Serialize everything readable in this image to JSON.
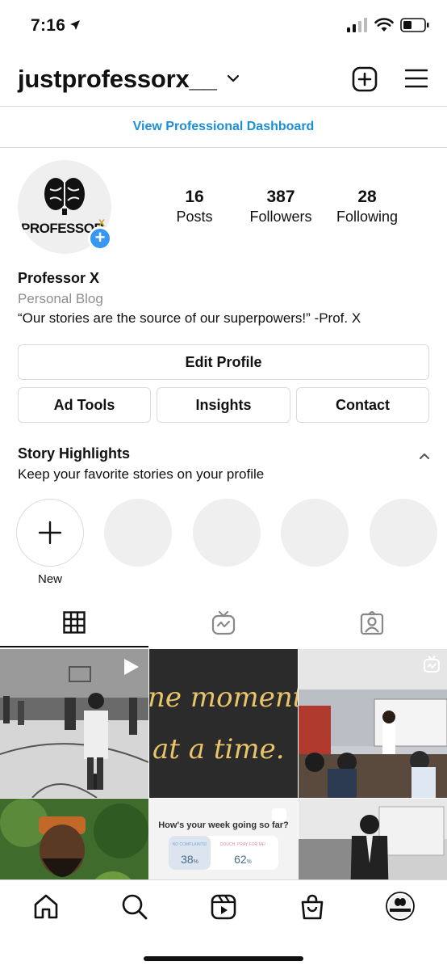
{
  "status_bar": {
    "time": "7:16"
  },
  "header": {
    "username": "justprofessorx__"
  },
  "dashboard_link": "View Professional Dashboard",
  "profile": {
    "avatar_text": "PROFESSOR X",
    "stats": [
      {
        "value": "16",
        "label": "Posts"
      },
      {
        "value": "387",
        "label": "Followers"
      },
      {
        "value": "28",
        "label": "Following"
      }
    ],
    "name": "Professor X",
    "category": "Personal Blog",
    "bio": "“Our stories are the source of our superpowers!” -Prof. X"
  },
  "buttons": {
    "edit_profile": "Edit Profile",
    "ad_tools": "Ad Tools",
    "insights": "Insights",
    "contact": "Contact"
  },
  "highlights": {
    "title": "Story Highlights",
    "subtitle": "Keep your favorite stories on your profile",
    "new_label": "New"
  },
  "tabs": [
    "grid-icon",
    "igtv-icon",
    "tagged-icon"
  ],
  "posts": [
    {
      "kind": "photo",
      "desc": "gym"
    },
    {
      "kind": "text",
      "lines": [
        "ne moment",
        "at a time."
      ]
    },
    {
      "kind": "photo",
      "desc": "classroom"
    },
    {
      "kind": "photo",
      "desc": "portrait"
    },
    {
      "kind": "poll",
      "question": "How's your week going so far?",
      "option_a_label": "NO COMPLAINTS!",
      "option_a_pct": "38",
      "option_b_label": "OOUCH. PRAY FOR ME!",
      "option_b_pct": "62",
      "pct_suffix": "%"
    },
    {
      "kind": "photo",
      "desc": "speaker"
    }
  ],
  "nav": [
    "home-icon",
    "search-icon",
    "reels-icon",
    "shop-icon",
    "profile-avatar"
  ],
  "colors": {
    "link_blue": "#1c8fd8",
    "add_blue": "#3897f0",
    "gold": "#e9c46a"
  }
}
